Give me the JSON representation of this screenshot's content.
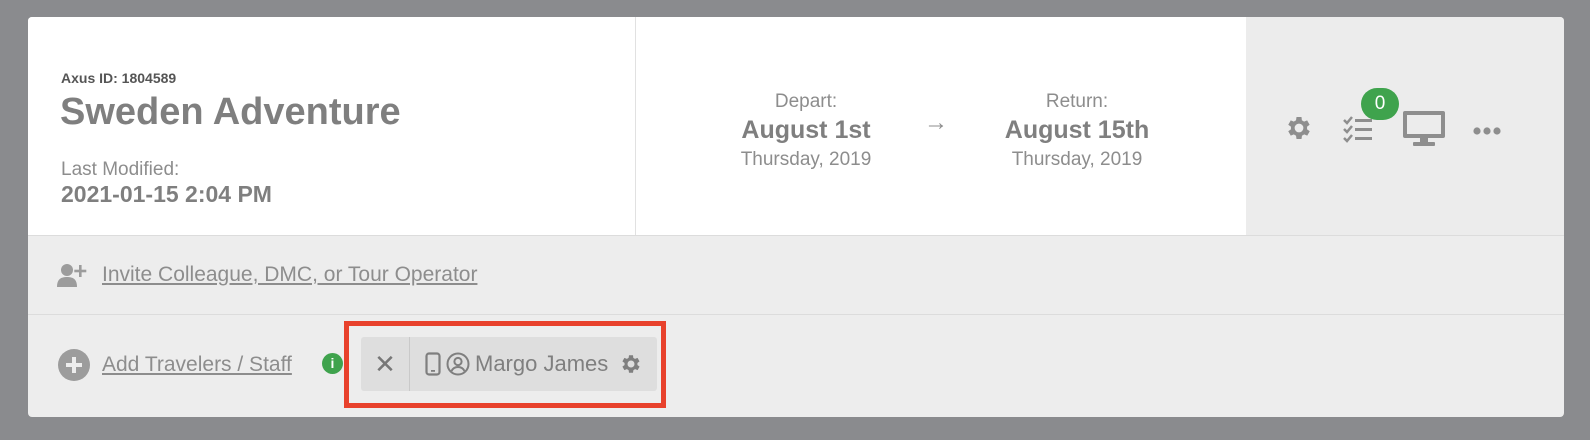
{
  "trip": {
    "axus_id": "Axus ID: 1804589",
    "title": "Sweden Adventure",
    "last_modified_label": "Last Modified:",
    "last_modified_value": "2021-01-15 2:04 PM"
  },
  "dates": {
    "depart_label": "Depart:",
    "depart_date": "August 1st",
    "depart_sub": "Thursday, 2019",
    "arrow": "→",
    "return_label": "Return:",
    "return_date": "August 15th",
    "return_sub": "Thursday, 2019"
  },
  "actions": {
    "checklist_badge": "0",
    "icons": [
      "gear-icon",
      "checklist-icon",
      "monitor-icon",
      "more-icon"
    ]
  },
  "invite": {
    "link_text": " Invite Colleague, DMC, or Tour Operator",
    "icon": "add-user-icon"
  },
  "travelers": {
    "add_link_text": "Add Travelers / Staff ",
    "info_icon": "i",
    "chip": {
      "close_symbol": "✕",
      "name": "Margo James"
    }
  },
  "colors": {
    "background": "#8a8b8e",
    "badge_green": "#3fa34d",
    "highlight_red": "#e8412c",
    "text_gray": "#7f7f7f"
  }
}
